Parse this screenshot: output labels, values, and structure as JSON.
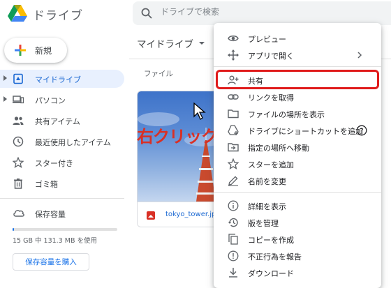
{
  "app": {
    "title": "ドライブ"
  },
  "search": {
    "placeholder": "ドライブで検索"
  },
  "sidebar": {
    "new_label": "新規",
    "items": [
      {
        "label": "マイドライブ",
        "icon": "my-drive-icon",
        "active": true,
        "expandable": true
      },
      {
        "label": "パソコン",
        "icon": "computer-icon",
        "active": false,
        "expandable": true
      },
      {
        "label": "共有アイテム",
        "icon": "shared-icon",
        "active": false,
        "expandable": false
      },
      {
        "label": "最近使用したアイテム",
        "icon": "clock-icon",
        "active": false,
        "expandable": false
      },
      {
        "label": "スター付き",
        "icon": "star-icon",
        "active": false,
        "expandable": false
      },
      {
        "label": "ゴミ箱",
        "icon": "trash-icon",
        "active": false,
        "expandable": false
      }
    ],
    "storage": {
      "label": "保存容量",
      "usage_text": "15 GB 中 131.3 MB を使用",
      "used_fraction": 0.009,
      "buy_label": "保存容量を購入"
    }
  },
  "main": {
    "title": "マイドライブ",
    "section_label": "ファイル",
    "file": {
      "name": "tokyo_tower.jpg",
      "icon": "image-file-icon"
    },
    "annotation": "右クリック"
  },
  "context_menu": {
    "items": [
      {
        "label": "プレビュー",
        "icon": "eye-icon"
      },
      {
        "label": "アプリで開く",
        "icon": "move-arrows-icon",
        "submenu": true
      },
      {
        "label": "共有",
        "icon": "person-add-icon",
        "highlighted": true
      },
      {
        "label": "リンクを取得",
        "icon": "link-icon"
      },
      {
        "label": "ファイルの場所を表示",
        "icon": "folder-icon"
      },
      {
        "label": "ドライブにショートカットを追加",
        "icon": "drive-shortcut-icon",
        "help": true
      },
      {
        "label": "指定の場所へ移動",
        "icon": "move-to-folder-icon"
      },
      {
        "label": "スターを追加",
        "icon": "star-icon"
      },
      {
        "label": "名前を変更",
        "icon": "pencil-icon"
      },
      {
        "label": "詳細を表示",
        "icon": "info-icon"
      },
      {
        "label": "版を管理",
        "icon": "history-icon"
      },
      {
        "label": "コピーを作成",
        "icon": "copy-icon"
      },
      {
        "label": "不正行為を報告",
        "icon": "report-icon"
      },
      {
        "label": "ダウンロード",
        "icon": "download-icon"
      }
    ]
  },
  "colors": {
    "accent": "#1a73e8",
    "active_nav_bg": "#e8f0fe",
    "highlight_border": "#e01b1b",
    "annotation": "#d93025"
  }
}
